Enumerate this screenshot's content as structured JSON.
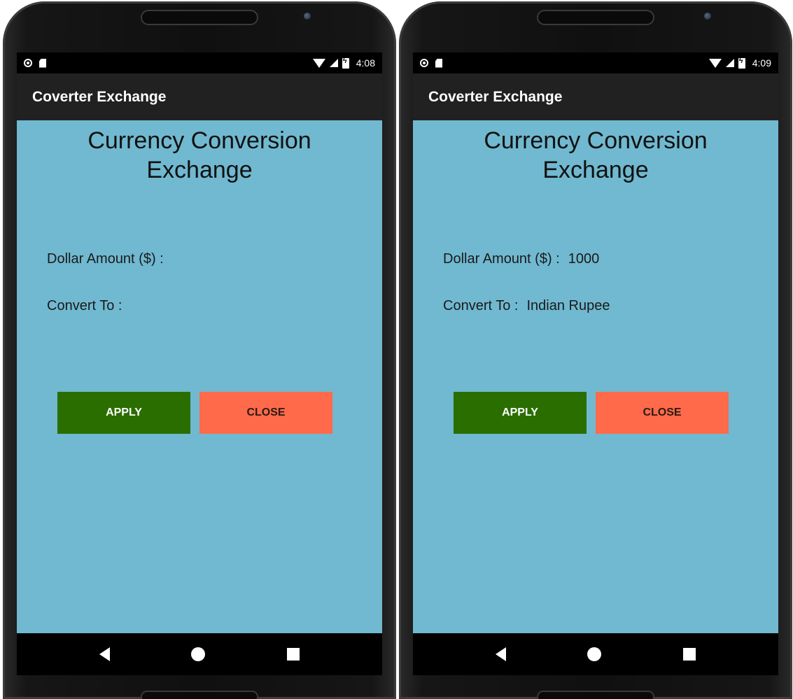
{
  "screens": [
    {
      "status": {
        "time": "4:08"
      },
      "appbar": {
        "title": "Coverter Exchange"
      },
      "headline": "Currency Conversion Exchange",
      "fields": {
        "amount_label": "Dollar Amount ($) :",
        "amount_value": "",
        "convert_label": "Convert To :",
        "convert_value": ""
      },
      "buttons": {
        "apply": "APPLY",
        "close": "CLOSE"
      }
    },
    {
      "status": {
        "time": "4:09"
      },
      "appbar": {
        "title": "Coverter Exchange"
      },
      "headline": "Currency Conversion Exchange",
      "fields": {
        "amount_label": "Dollar Amount ($) :",
        "amount_value": "1000",
        "convert_label": "Convert To :",
        "convert_value": "Indian Rupee"
      },
      "buttons": {
        "apply": "APPLY",
        "close": "CLOSE"
      }
    }
  ],
  "colors": {
    "content_bg": "#70b9d0",
    "appbar_bg": "#212121",
    "apply_bg": "#2a6e00",
    "close_bg": "#ff6a4b"
  },
  "icons": {
    "status_left": [
      "circle-icon",
      "sd-card-icon"
    ],
    "status_right": [
      "wifi-icon",
      "signal-icon",
      "battery-charging-icon"
    ],
    "nav": [
      "back-icon",
      "home-icon",
      "recent-apps-icon"
    ]
  }
}
